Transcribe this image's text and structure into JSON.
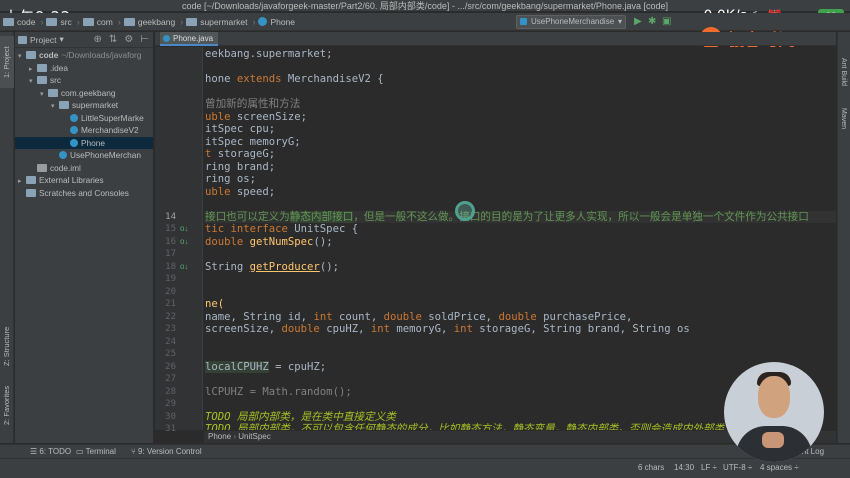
{
  "window": {
    "title": "code [~/Downloads/javaforgeek-master/Part2/60. 局部内部类/code] - .../src/com/geekbang/supermarket/Phone.java [code]"
  },
  "os_status": {
    "time": "上午9:22",
    "net_speed": "0.0K/s",
    "battery": "96"
  },
  "logo": {
    "text": "极客时间"
  },
  "nav": {
    "crumbs": [
      "code",
      "src",
      "com",
      "geekbang",
      "supermarket",
      "Phone"
    ],
    "run_config": "UsePhoneMerchandise"
  },
  "left_strip": {
    "project_tab": "1: Project",
    "structure_tab": "Z: Structure",
    "favorites_tab": "2: Favorites"
  },
  "right_strip": {
    "ant_build": "Ant Build",
    "maven": "Maven"
  },
  "project": {
    "header": "Project",
    "tree": [
      {
        "label": "code",
        "extra": "~/Downloads/javaforg",
        "depth": 0,
        "kind": "folder",
        "open": true,
        "bold": true
      },
      {
        "label": ".idea",
        "depth": 1,
        "kind": "folder",
        "open": false
      },
      {
        "label": "src",
        "depth": 1,
        "kind": "folder",
        "open": true
      },
      {
        "label": "com.geekbang",
        "depth": 2,
        "kind": "package",
        "open": true
      },
      {
        "label": "supermarket",
        "depth": 3,
        "kind": "package",
        "open": true
      },
      {
        "label": "LittleSuperMarke",
        "depth": 4,
        "kind": "class"
      },
      {
        "label": "MerchandiseV2",
        "depth": 4,
        "kind": "class"
      },
      {
        "label": "Phone",
        "depth": 4,
        "kind": "class",
        "selected": true
      },
      {
        "label": "UsePhoneMerchan",
        "depth": 3,
        "kind": "class"
      },
      {
        "label": "code.iml",
        "depth": 1,
        "kind": "file"
      },
      {
        "label": "External Libraries",
        "depth": 0,
        "kind": "lib",
        "open": false
      },
      {
        "label": "Scratches and Consoles",
        "depth": 0,
        "kind": "scratch"
      }
    ]
  },
  "editor": {
    "tab": "Phone.java",
    "lines": [
      {
        "num": "",
        "segs": [
          {
            "t": "eekbang.supermarket;",
            "c": "ty"
          }
        ]
      },
      {
        "num": "",
        "segs": []
      },
      {
        "num": "",
        "segs": [
          {
            "t": "hone ",
            "c": "ty"
          },
          {
            "t": "extends ",
            "c": "kw"
          },
          {
            "t": "MerchandiseV2 {",
            "c": "ty"
          }
        ]
      },
      {
        "num": "",
        "segs": []
      },
      {
        "num": "",
        "segs": [
          {
            "t": "曾加新的属性和方法",
            "c": "cm"
          }
        ]
      },
      {
        "num": "",
        "segs": [
          {
            "t": "uble ",
            "c": "kw"
          },
          {
            "t": "screenSize;",
            "c": "ty"
          }
        ]
      },
      {
        "num": "",
        "segs": [
          {
            "t": "itSpec cpu;",
            "c": "ty"
          }
        ]
      },
      {
        "num": "",
        "segs": [
          {
            "t": "itSpec memoryG;",
            "c": "ty"
          }
        ]
      },
      {
        "num": "",
        "segs": [
          {
            "t": "t ",
            "c": "kw"
          },
          {
            "t": "storageG;",
            "c": "ty"
          }
        ]
      },
      {
        "num": "",
        "segs": [
          {
            "t": "ring brand;",
            "c": "ty"
          }
        ]
      },
      {
        "num": "",
        "segs": [
          {
            "t": "ring os;",
            "c": "ty"
          }
        ]
      },
      {
        "num": "",
        "segs": [
          {
            "t": "uble ",
            "c": "kw"
          },
          {
            "t": "speed;",
            "c": "ty"
          }
        ]
      },
      {
        "num": "",
        "segs": []
      },
      {
        "num": "14",
        "segs": [
          {
            "t": " 接口也可以定义为",
            "c": "cmz"
          },
          {
            "t": "静态内部接口",
            "c": "cmz hl"
          },
          {
            "t": "，但是一般不这么做。接口的目的是为了让更多人实现，所以一般会是单独一个文件作为公共接口",
            "c": "cmz"
          }
        ],
        "cur": true
      },
      {
        "num": "15",
        "segs": [
          {
            "t": "tic ",
            "c": "kw"
          },
          {
            "t": "interface ",
            "c": "kw"
          },
          {
            "t": "UnitSpec {",
            "c": "ty"
          }
        ],
        "mark": "o↓"
      },
      {
        "num": "16",
        "segs": [
          {
            "t": " double ",
            "c": "kw"
          },
          {
            "t": "getNumSpec",
            "c": "fn"
          },
          {
            "t": "();",
            "c": "ty"
          }
        ],
        "mark": "o↓"
      },
      {
        "num": "17",
        "segs": []
      },
      {
        "num": "18",
        "segs": [
          {
            "t": " String ",
            "c": "ty"
          },
          {
            "t": "getProducer",
            "c": "fn ul"
          },
          {
            "t": "();",
            "c": "ty"
          }
        ],
        "mark": "o↓"
      },
      {
        "num": "19",
        "segs": []
      },
      {
        "num": "20",
        "segs": []
      },
      {
        "num": "21",
        "segs": [
          {
            "t": "ne(",
            "c": "fn"
          }
        ]
      },
      {
        "num": "22",
        "segs": [
          {
            "t": " name, String id, ",
            "c": "ty"
          },
          {
            "t": "int ",
            "c": "kw"
          },
          {
            "t": "count, ",
            "c": "ty"
          },
          {
            "t": "double ",
            "c": "kw"
          },
          {
            "t": "soldPrice, ",
            "c": "ty"
          },
          {
            "t": "double ",
            "c": "kw"
          },
          {
            "t": "purchasePrice,",
            "c": "ty"
          }
        ]
      },
      {
        "num": "23",
        "segs": [
          {
            "t": " screenSize, ",
            "c": "ty"
          },
          {
            "t": "double ",
            "c": "kw"
          },
          {
            "t": "cpuHZ, ",
            "c": "ty"
          },
          {
            "t": "int ",
            "c": "kw"
          },
          {
            "t": "memoryG, ",
            "c": "ty"
          },
          {
            "t": "int ",
            "c": "kw"
          },
          {
            "t": "storageG, String brand, String os",
            "c": "ty"
          }
        ]
      },
      {
        "num": "24",
        "segs": []
      },
      {
        "num": "25",
        "segs": []
      },
      {
        "num": "26",
        "segs": [
          {
            "t": " ",
            "c": "ty"
          },
          {
            "t": "localCPUHZ",
            "c": "ty hl"
          },
          {
            "t": " = cpuHZ;",
            "c": "ty"
          }
        ]
      },
      {
        "num": "27",
        "segs": []
      },
      {
        "num": "28",
        "segs": [
          {
            "t": "lCPUHZ = Math.",
            "c": "cm"
          },
          {
            "t": "random",
            "c": "cm"
          },
          {
            "t": "();",
            "c": "cm"
          }
        ]
      },
      {
        "num": "29",
        "segs": []
      },
      {
        "num": "30",
        "segs": [
          {
            "t": "TODO 局部内部类，是在类中直接定义类",
            "c": "todo"
          }
        ]
      },
      {
        "num": "31",
        "segs": [
          {
            "t": "TODO 局部内部类，不可以包含任何静态的成分，比如静态方法，静态变量，静态内部类。否则会造成内外部类",
            "c": "todo"
          }
        ]
      }
    ],
    "breadcrumb": [
      "Phone",
      "UnitSpec"
    ]
  },
  "tool_windows": {
    "todo": "6: TODO",
    "terminal": "Terminal",
    "version_control": "9: Version Control",
    "event_log": "Event Log"
  },
  "status": {
    "chars": "6 chars",
    "position": "14:30",
    "line_sep": "LF ÷",
    "encoding": "UTF-8 ÷",
    "indent": "4 spaces ÷"
  }
}
